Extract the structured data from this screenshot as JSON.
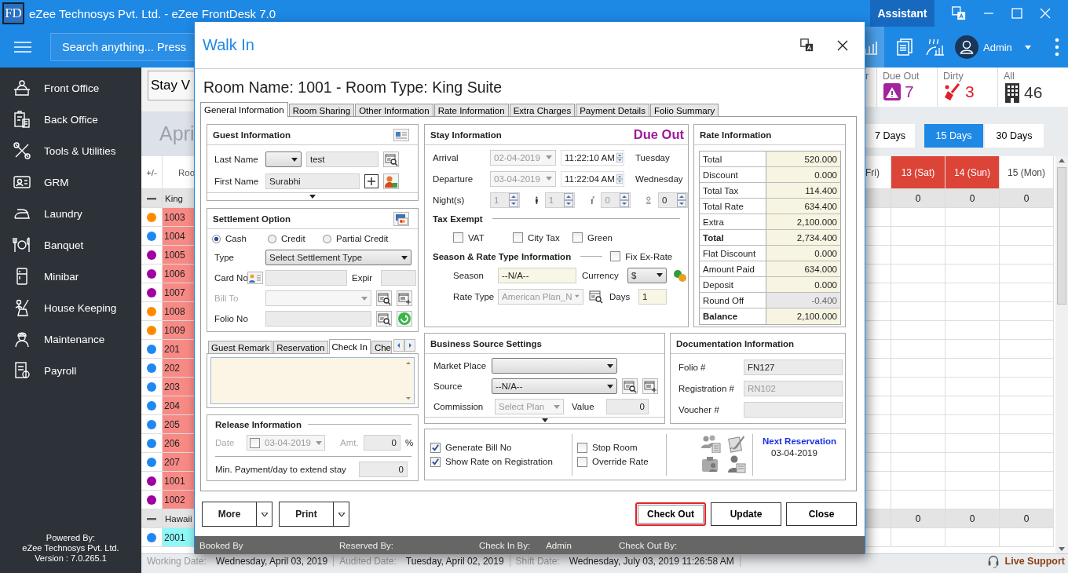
{
  "app": {
    "logo": "FD",
    "title": "eZee Technosys Pvt. Ltd. - eZee FrontDesk 7.0",
    "assistant": "Assistant",
    "search_placeholder": "Search anything... Press",
    "user": "Admin"
  },
  "sidebar": {
    "items": [
      {
        "label": "Front Office"
      },
      {
        "label": "Back Office"
      },
      {
        "label": "Tools & Utilities"
      },
      {
        "label": "GRM"
      },
      {
        "label": "Laundry"
      },
      {
        "label": "Banquet"
      },
      {
        "label": "Minibar"
      },
      {
        "label": "House Keeping"
      },
      {
        "label": "Maintenance"
      },
      {
        "label": "Payroll"
      }
    ],
    "powered_by": "Powered By:",
    "company": "eZee Technosys Pvt. Ltd.",
    "version": "Version : 7.0.265.1"
  },
  "background": {
    "view_button": "Stay V",
    "month": "Apri",
    "columns": [
      "+/-",
      "Roo"
    ],
    "stats": [
      {
        "kind": "partial",
        "label": "r"
      },
      {
        "kind": "due_out",
        "label": "Due Out",
        "value": "7",
        "color": "#a3239c"
      },
      {
        "kind": "dirty",
        "label": "Dirty",
        "value": "3",
        "color": "#e0202a"
      },
      {
        "kind": "all",
        "label": "All",
        "value": "46",
        "color": "#333333"
      }
    ],
    "day_ranges": [
      {
        "label": "7 Days",
        "selected": false
      },
      {
        "label": "15 Days",
        "selected": true
      },
      {
        "label": "30 Days",
        "selected": false
      }
    ],
    "calendar": {
      "clipped_column": "Fri)",
      "columns": [
        {
          "label": "13 (Sat)",
          "weekend": true
        },
        {
          "label": "14 (Sun)",
          "weekend": true
        },
        {
          "label": "15 (Mon)",
          "weekend": false
        }
      ]
    },
    "groups": [
      {
        "label": "King",
        "color": "#f88a86",
        "totals": [
          "0",
          "0",
          "0"
        ],
        "rooms": [
          {
            "number": "1003",
            "color": "#ff8a00"
          },
          {
            "number": "1004",
            "color": "#1e88f0"
          },
          {
            "number": "1005",
            "color": "#a000a0"
          },
          {
            "number": "1006",
            "color": "#a000a0"
          },
          {
            "number": "1007",
            "color": "#a000a0"
          },
          {
            "number": "1008",
            "color": "#ff8a00"
          },
          {
            "number": "1009",
            "color": "#ff8a00"
          },
          {
            "number": "201",
            "color": "#1e88f0"
          },
          {
            "number": "202",
            "color": "#1e88f0"
          },
          {
            "number": "203",
            "color": "#1e88f0"
          },
          {
            "number": "204",
            "color": "#1e88f0"
          },
          {
            "number": "205",
            "color": "#1e88f0"
          },
          {
            "number": "206",
            "color": "#1e88f0"
          },
          {
            "number": "207",
            "color": "#1e88f0"
          },
          {
            "number": "1001",
            "color": "#a000a0"
          },
          {
            "number": "1002",
            "color": "#a000a0"
          }
        ]
      },
      {
        "label": "Hawaii",
        "color": "#8ef8f8",
        "totals": [
          "0",
          "0",
          "0"
        ],
        "rooms": [
          {
            "number": "2001",
            "color": "#1e88f0"
          }
        ]
      }
    ]
  },
  "status_bar": {
    "items": [
      {
        "label": "Working Date:",
        "value": "Wednesday, April 03, 2019"
      },
      {
        "label": "Audited Date:",
        "value": "Tuesday, April 02, 2019"
      },
      {
        "label": "Shift Date:",
        "value": "Wednesday, July 03, 2019 11:26:58 AM"
      }
    ],
    "live_support": "Live Support"
  },
  "dialog": {
    "title": "Walk In",
    "heading": "Room Name: 1001 - Room Type: King Suite",
    "tabs": [
      {
        "label": "General Information",
        "selected": true
      },
      {
        "label": "Room Sharing",
        "selected": false
      },
      {
        "label": "Other Information",
        "selected": false
      },
      {
        "label": "Rate Information",
        "selected": false
      },
      {
        "label": "Extra Charges",
        "selected": false
      },
      {
        "label": "Payment Details",
        "selected": false
      },
      {
        "label": "Folio Summary",
        "selected": false
      }
    ],
    "guest": {
      "title": "Guest Information",
      "last_name": {
        "label": "Last Name",
        "value": "test"
      },
      "first_name": {
        "label": "First Name",
        "value": "Surabhi"
      }
    },
    "settlement": {
      "title": "Settlement Option",
      "modes": [
        {
          "label": "Cash",
          "selected": true
        },
        {
          "label": "Credit",
          "selected": false
        },
        {
          "label": "Partial Credit",
          "selected": false
        }
      ],
      "type": {
        "label": "Type",
        "value": "Select Settlement Type"
      },
      "card_no": {
        "label": "Card No"
      },
      "expiry": {
        "label": "Expir"
      },
      "bill_to": {
        "label": "Bill To",
        "disabled": true
      },
      "folio_no": {
        "label": "Folio No"
      }
    },
    "remark_tabs": [
      {
        "label": "Guest Remark",
        "selected": false
      },
      {
        "label": "Reservation",
        "selected": false
      },
      {
        "label": "Check In",
        "selected": true
      },
      {
        "label": "Che",
        "selected": false
      }
    ],
    "release": {
      "title": "Release Information",
      "disabled": true,
      "date_label": "Date",
      "date": "03-04-2019",
      "date_checked": false,
      "amount_label": "Amt.",
      "amount": "0",
      "percent": "%",
      "min_payment_label": "Min. Payment/day to extend stay",
      "min_payment": "0"
    },
    "stay": {
      "title": "Stay Information",
      "status": "Due Out",
      "dates": [
        {
          "label": "Arrival",
          "date": "02-04-2019",
          "time": "11:22:10 AM",
          "day": "Tuesday",
          "disabled": true
        },
        {
          "label": "Departure",
          "date": "03-04-2019",
          "time": "11:22:04 AM",
          "day": "Wednesday",
          "disabled": true
        }
      ],
      "occupancy": [
        {
          "kind": "nights",
          "label": "Night(s)",
          "value": "1",
          "disabled": true
        },
        {
          "kind": "adults",
          "value": "1",
          "disabled": true
        },
        {
          "kind": "children",
          "value": "0",
          "disabled": true
        },
        {
          "kind": "infants",
          "value": "0",
          "disabled": false
        }
      ],
      "tax_exempt": {
        "title": "Tax Exempt",
        "options": [
          {
            "label": "VAT",
            "checked": false
          },
          {
            "label": "City Tax",
            "checked": false
          },
          {
            "label": "Green",
            "checked": false
          }
        ]
      },
      "season_title": "Season & Rate Type Information",
      "fix_ex_rate": {
        "label": "Fix Ex-Rate",
        "checked": false
      },
      "season": {
        "label": "Season",
        "value": "--N/A--"
      },
      "currency": {
        "label": "Currency",
        "value": "$"
      },
      "rate_type": {
        "label": "Rate Type",
        "value": "American Plan_N",
        "disabled": true
      },
      "days": {
        "label": "Days",
        "value": "1"
      }
    },
    "rate": {
      "title": "Rate Information",
      "rows": [
        {
          "label": "Total",
          "value": "520.000",
          "bold": false,
          "readonly": false
        },
        {
          "label": "Discount",
          "value": "0.000",
          "bold": false,
          "readonly": false
        },
        {
          "label": "Total Tax",
          "value": "114.400",
          "bold": false,
          "readonly": false
        },
        {
          "label": "Total Rate",
          "value": "634.400",
          "bold": false,
          "readonly": false
        },
        {
          "label": "Extra",
          "value": "2,100.000",
          "bold": false,
          "readonly": false
        },
        {
          "label": "Total",
          "value": "2,734.400",
          "bold": true,
          "readonly": false
        },
        {
          "label": "Flat Discount",
          "value": "0.000",
          "bold": false,
          "readonly": false
        },
        {
          "label": "Amount Paid",
          "value": "634.000",
          "bold": false,
          "readonly": false
        },
        {
          "label": "Deposit",
          "value": "0.000",
          "bold": false,
          "readonly": false
        },
        {
          "label": "Round Off",
          "value": "-0.400",
          "bold": false,
          "readonly": true
        },
        {
          "label": "Balance",
          "value": "2,100.000",
          "bold": true,
          "readonly": false
        }
      ]
    },
    "business": {
      "title": "Business Source Settings",
      "market_place": {
        "label": "Market Place"
      },
      "source": {
        "label": "Source",
        "value": "--N/A--"
      },
      "commission": {
        "label": "Commission",
        "value": "Select Plan",
        "disabled": true
      },
      "value": {
        "label": "Value",
        "value": "0"
      }
    },
    "documentation": {
      "title": "Documentation Information",
      "fields": [
        {
          "label": "Folio #",
          "value": "FN127",
          "disabled": false
        },
        {
          "label": "Registration #",
          "value": "RN102",
          "disabled": true
        },
        {
          "label": "Voucher #"
        }
      ]
    },
    "option_columns": [
      {
        "options": [
          {
            "label": "Generate Bill No",
            "checked": true
          },
          {
            "label": "Show Rate on Registration",
            "checked": true
          }
        ]
      },
      {
        "options": [
          {
            "label": "Stop Room",
            "checked": false
          },
          {
            "label": "Override Rate",
            "checked": false
          }
        ]
      }
    ],
    "next_reservation": {
      "title": "Next Reservation",
      "date": "03-04-2019"
    },
    "split_buttons": [
      {
        "label": "More"
      },
      {
        "label": "Print"
      }
    ],
    "buttons": [
      {
        "label": "Check Out",
        "highlighted": true
      },
      {
        "label": "Update",
        "highlighted": false
      },
      {
        "label": "Close",
        "highlighted": false
      }
    ],
    "footer": [
      {
        "label": "Booked By"
      },
      {
        "label": "Reserved By:"
      },
      {
        "label": "Check In By:",
        "value": "Admin"
      },
      {
        "label": "Check Out By:"
      }
    ]
  }
}
